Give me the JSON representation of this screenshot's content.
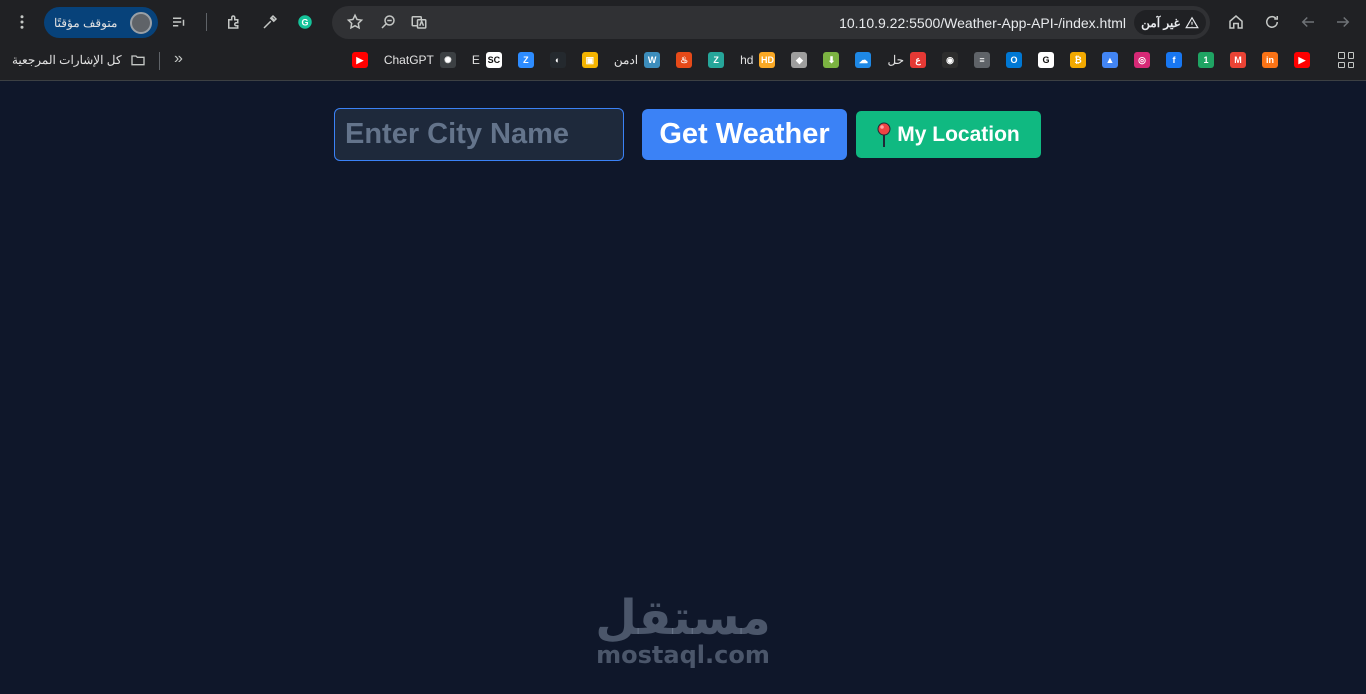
{
  "browser": {
    "url": "10.10.9.22:5500/Weather-App-API-/index.html",
    "security_label": "غير آمن",
    "profile_status": "متوقف مؤقتًا",
    "bookmarks_folder_label": "كل الإشارات المرجعية",
    "bookmarks": [
      {
        "name": "youtube",
        "label": "",
        "color": "#ff0000",
        "glyph": "▶"
      },
      {
        "name": "iconscout",
        "label": "",
        "color": "#f97316",
        "glyph": "in"
      },
      {
        "name": "gmail",
        "label": "",
        "color": "#ea4335",
        "glyph": "M"
      },
      {
        "name": "one",
        "label": "",
        "color": "#1fa463",
        "glyph": "1"
      },
      {
        "name": "facebook",
        "label": "",
        "color": "#1877f2",
        "glyph": "f"
      },
      {
        "name": "instagram",
        "label": "",
        "color": "#d62976",
        "glyph": "◎"
      },
      {
        "name": "google-classroom",
        "label": "",
        "color": "#4285f4",
        "glyph": "▲"
      },
      {
        "name": "bitcoin",
        "label": "",
        "color": "#f2a900",
        "glyph": "₿"
      },
      {
        "name": "google",
        "label": "",
        "color": "#ffffff",
        "glyph": "G"
      },
      {
        "name": "outlook",
        "label": "",
        "color": "#0078d4",
        "glyph": "O"
      },
      {
        "name": "dictionary",
        "label": "",
        "color": "#5f6368",
        "glyph": "≡"
      },
      {
        "name": "pointer",
        "label": "",
        "color": "#2d2d2d",
        "glyph": "◉"
      },
      {
        "name": "3ain",
        "label": "حل",
        "color": "#e53935",
        "glyph": "ع"
      },
      {
        "name": "cloud-download",
        "label": "",
        "color": "#1e88e5",
        "glyph": "☁"
      },
      {
        "name": "download-arrow",
        "label": "",
        "color": "#7cb342",
        "glyph": "⬇"
      },
      {
        "name": "layers",
        "label": "",
        "color": "#9e9e9e",
        "glyph": "◆"
      },
      {
        "name": "hd",
        "label": "hd",
        "color": "#f9a825",
        "glyph": "HD"
      },
      {
        "name": "z-app",
        "label": "",
        "color": "#26a69a",
        "glyph": "Z"
      },
      {
        "name": "fire",
        "label": "",
        "color": "#e64a19",
        "glyph": "♨"
      },
      {
        "name": "wordpress",
        "label": "ادمن",
        "color": "#3c8dbc",
        "glyph": "W"
      },
      {
        "name": "google-slides",
        "label": "",
        "color": "#f4b400",
        "glyph": "▣"
      },
      {
        "name": "github",
        "label": "",
        "color": "#24292e",
        "glyph": "◐"
      },
      {
        "name": "zoom",
        "label": "",
        "color": "#2d8cff",
        "glyph": "Z"
      },
      {
        "name": "sc",
        "label": "E",
        "color": "#ffffff",
        "glyph": "SC"
      },
      {
        "name": "chatgpt",
        "label": "ChatGPT",
        "color": "#3c4043",
        "glyph": "✺"
      },
      {
        "name": "youtube-2",
        "label": "",
        "color": "#ff0000",
        "glyph": "▶"
      }
    ]
  },
  "app": {
    "city_placeholder": "Enter City Name",
    "get_weather_label": "Get Weather",
    "my_location_label": "My Location"
  },
  "watermark": {
    "arabic": "مستقل",
    "domain": "mostaql.com"
  },
  "colors": {
    "page_bg": "#0f172a",
    "input_bg": "#1e293b",
    "primary": "#3b82f6",
    "location": "#10b981"
  }
}
